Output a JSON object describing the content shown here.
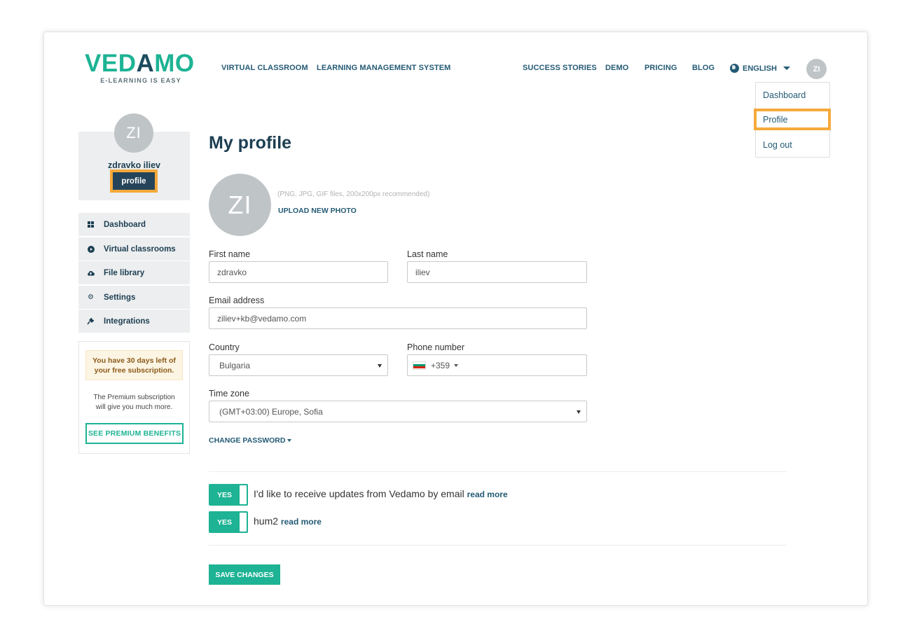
{
  "brand": {
    "logo_text_green_1": "VED",
    "logo_text_dark": "A",
    "logo_text_green_2": "MO",
    "tagline": "E-LEARNING IS EASY"
  },
  "nav": {
    "virtual_classroom": "VIRTUAL CLASSROOM",
    "lms": "LEARNING MANAGEMENT SYSTEM",
    "success_stories": "SUCCESS STORIES",
    "demo": "DEMO",
    "pricing": "PRICING",
    "blog": "BLOG",
    "language": "ENGLISH",
    "user_initials": "ZI"
  },
  "user_menu": {
    "dashboard": "Dashboard",
    "profile": "Profile",
    "logout": "Log out"
  },
  "sidebar": {
    "initials": "ZI",
    "name": "zdravko iliev",
    "profile_button": "profile",
    "items": [
      {
        "label": "Dashboard",
        "icon": "grid-icon"
      },
      {
        "label": "Virtual classrooms",
        "icon": "play-circle-icon"
      },
      {
        "label": "File library",
        "icon": "cloud-upload-icon"
      },
      {
        "label": "Settings",
        "icon": "gear-icon"
      },
      {
        "label": "Integrations",
        "icon": "plug-icon"
      }
    ],
    "trial_note_line1": "You have 30 days left of",
    "trial_note_line2": "your free subscription.",
    "premium_text_line1": "The Premium subscription",
    "premium_text_line2": "will give you much more.",
    "premium_button": "SEE PREMIUM BENEFITS"
  },
  "main": {
    "title": "My profile",
    "avatar_initials": "ZI",
    "photo_hint": "(PNG, JPG, GIF files, 200x200px recommended)",
    "upload_label": "UPLOAD NEW PHOTO",
    "first_name_label": "First name",
    "first_name_value": "zdravko",
    "last_name_label": "Last name",
    "last_name_value": "iliev",
    "email_label": "Email address",
    "email_value": "ziliev+kb@vedamo.com",
    "country_label": "Country",
    "country_value": "Bulgaria",
    "phone_label": "Phone number",
    "phone_code": "+359",
    "timezone_label": "Time zone",
    "timezone_value": "(GMT+03:00) Europe, Sofia",
    "change_password": "CHANGE PASSWORD",
    "toggle_yes": "YES",
    "consent_email_text": "I'd like to receive updates from Vedamo by email",
    "consent_hum2_text": "hum2",
    "read_more": "read more",
    "save_button": "SAVE CHANGES"
  },
  "colors": {
    "brand_green": "#1db394",
    "brand_dark": "#1d4b5e",
    "highlight_orange": "#f5a93a",
    "link_blue": "#245a75"
  }
}
